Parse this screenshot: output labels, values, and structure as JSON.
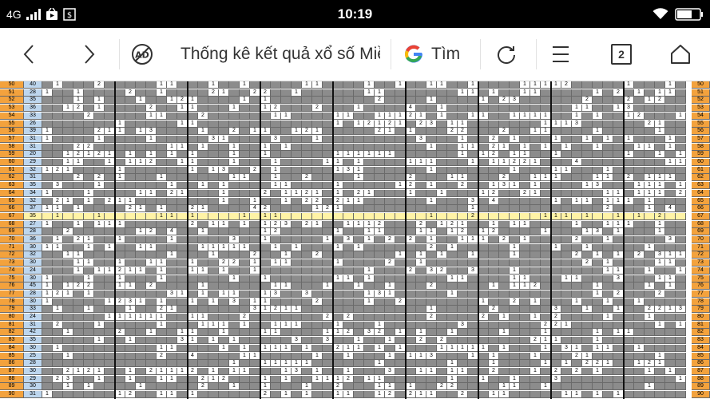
{
  "status_bar": {
    "network": "4G",
    "time": "10:19",
    "icons": [
      "signal-icon",
      "video-icon",
      "money-icon",
      "wifi-icon",
      "battery-icon"
    ]
  },
  "toolbar": {
    "page_title": "Thống kê kết quả xổ số Miề",
    "search_label": "Tìm",
    "tab_count": "2",
    "icons": [
      "back-icon",
      "forward-icon",
      "ad-block-icon",
      "google-icon",
      "reload-icon",
      "menu-icon",
      "tab-count-icon",
      "home-icon"
    ]
  },
  "grid": {
    "rows": [
      {
        "n": "50",
        "c": "40"
      },
      {
        "n": "51",
        "c": "28"
      },
      {
        "n": "52",
        "c": "35"
      },
      {
        "n": "53",
        "c": "36"
      },
      {
        "n": "54",
        "c": "33"
      },
      {
        "n": "55",
        "c": "26"
      },
      {
        "n": "56",
        "c": "39"
      },
      {
        "n": "57",
        "c": "31"
      },
      {
        "n": "58",
        "c": "31"
      },
      {
        "n": "59",
        "c": "20"
      },
      {
        "n": "60",
        "c": "29"
      },
      {
        "n": "61",
        "c": "32"
      },
      {
        "n": "62",
        "c": "31"
      },
      {
        "n": "63",
        "c": "35"
      },
      {
        "n": "64",
        "c": "34"
      },
      {
        "n": "65",
        "c": "32"
      },
      {
        "n": "66",
        "c": "37"
      },
      {
        "n": "67",
        "c": "35"
      },
      {
        "n": "68",
        "c": "27"
      },
      {
        "n": "69",
        "c": "28"
      },
      {
        "n": "70",
        "c": "36"
      },
      {
        "n": "71",
        "c": "30"
      },
      {
        "n": "72",
        "c": "32"
      },
      {
        "n": "73",
        "c": "30"
      },
      {
        "n": "74",
        "c": "24"
      },
      {
        "n": "75",
        "c": "30"
      },
      {
        "n": "76",
        "c": "45"
      },
      {
        "n": "77",
        "c": "28"
      },
      {
        "n": "78",
        "c": "30"
      },
      {
        "n": "79",
        "c": "33"
      },
      {
        "n": "80",
        "c": "24"
      },
      {
        "n": "81",
        "c": "31"
      },
      {
        "n": "82",
        "c": "42"
      },
      {
        "n": "83",
        "c": "35"
      },
      {
        "n": "84",
        "c": "30"
      },
      {
        "n": "85",
        "c": "25"
      },
      {
        "n": "86",
        "c": "28"
      },
      {
        "n": "87",
        "c": "30"
      },
      {
        "n": "88",
        "c": "29"
      },
      {
        "n": "89",
        "c": "30"
      },
      {
        "n": "90",
        "c": "31"
      }
    ],
    "highlighted_row": "67"
  }
}
